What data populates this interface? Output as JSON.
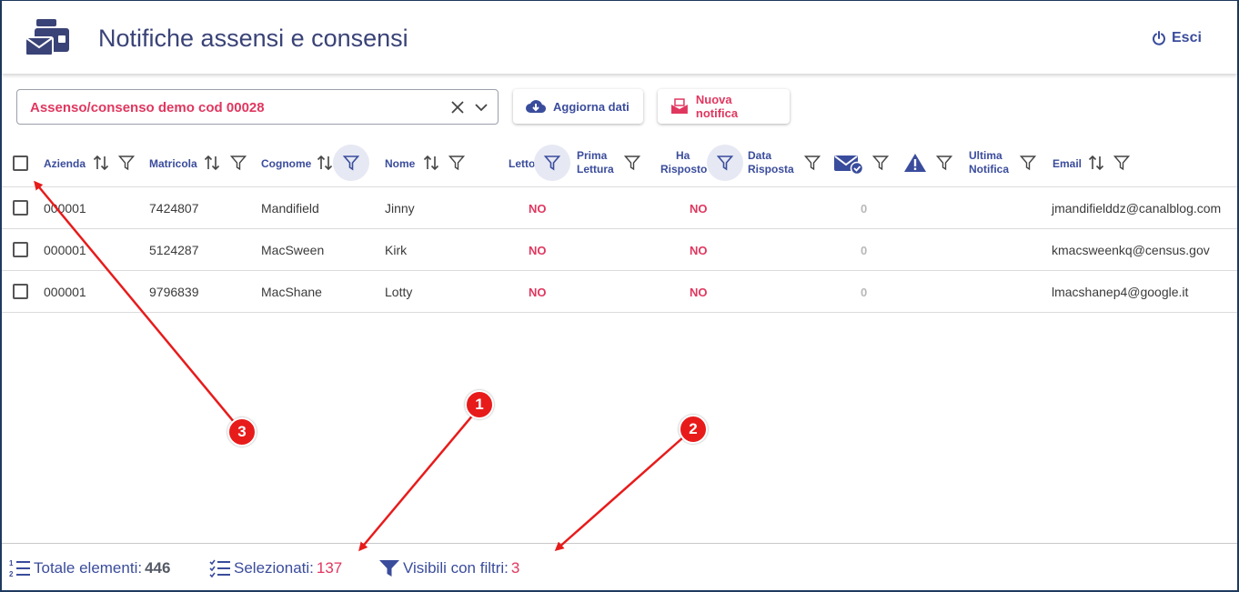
{
  "header": {
    "title": "Notifiche assensi e consensi",
    "logout_label": "Esci"
  },
  "toolbar": {
    "select_value": "Assenso/consenso demo cod 00028",
    "refresh_label": "Aggiorna dati",
    "new_label": "Nuova notifica"
  },
  "table": {
    "headers": {
      "azienda": "Azienda",
      "matricola": "Matricola",
      "cognome": "Cognome",
      "nome": "Nome",
      "letto": "Letto",
      "prima_lettura_1": "Prima",
      "prima_lettura_2": "Lettura",
      "ha_risposto_1": "Ha",
      "ha_risposto_2": "Risposto",
      "data_risposta_1": "Data",
      "data_risposta_2": "Risposta",
      "ultima_notifica_1": "Ultima",
      "ultima_notifica_2": "Notifica",
      "email": "Email"
    },
    "rows": [
      {
        "azienda": "000001",
        "matricola": "7424807",
        "cognome": "Mandifield",
        "nome": "Jinny",
        "letto": "NO",
        "ha_risposto": "NO",
        "count": "0",
        "email": "jmandifielddz@canalblog.com"
      },
      {
        "azienda": "000001",
        "matricola": "5124287",
        "cognome": "MacSween",
        "nome": "Kirk",
        "letto": "NO",
        "ha_risposto": "NO",
        "count": "0",
        "email": "kmacsweenkq@census.gov"
      },
      {
        "azienda": "000001",
        "matricola": "9796839",
        "cognome": "MacShane",
        "nome": "Lotty",
        "letto": "NO",
        "ha_risposto": "NO",
        "count": "0",
        "email": "lmacshanep4@google.it"
      }
    ]
  },
  "footer": {
    "totale_label": "Totale elementi:",
    "totale_value": "446",
    "selezionati_label": "Selezionati:",
    "selezionati_value": "137",
    "visibili_label": "Visibili con filtri:",
    "visibili_value": "3"
  },
  "annotations": {
    "badge_1": "1",
    "badge_2": "2",
    "badge_3": "3"
  },
  "colors": {
    "accent": "#3a4c9c",
    "pink": "#e0375f",
    "annotation_red": "#e81b1b"
  }
}
